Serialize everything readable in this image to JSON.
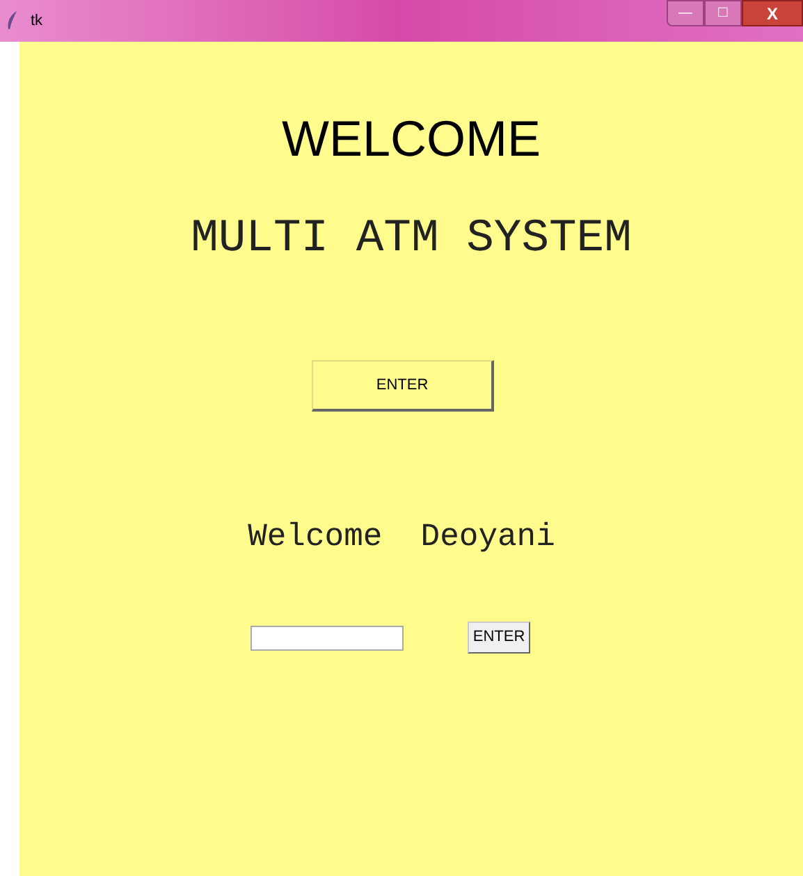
{
  "window": {
    "title": "tk",
    "controls": [
      "—",
      "□",
      "X"
    ]
  },
  "heading": "WELCOME",
  "subtitle": "MULTI ATM SYSTEM",
  "enter_button": "ENTER",
  "greeting": "Welcome  Deoyani",
  "form": {
    "button": "ENTER"
  }
}
